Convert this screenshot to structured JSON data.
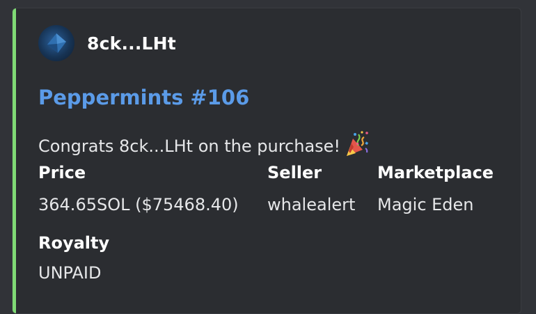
{
  "embed": {
    "accent_color": "#7fda75",
    "author": {
      "name": "8ck...LHt",
      "avatar_icon": "blue-diamond-avatar-icon"
    },
    "title": "Peppermints #106",
    "description": "Congrats 8ck...LHt on the purchase!",
    "description_emoji": "party-popper-icon",
    "fields": [
      {
        "name": "Price",
        "value": "364.65SOL ($75468.40)"
      },
      {
        "name": "Seller",
        "value": "whalealert"
      },
      {
        "name": "Marketplace",
        "value": "Magic Eden"
      },
      {
        "name": "Royalty",
        "value": "UNPAID"
      }
    ]
  }
}
